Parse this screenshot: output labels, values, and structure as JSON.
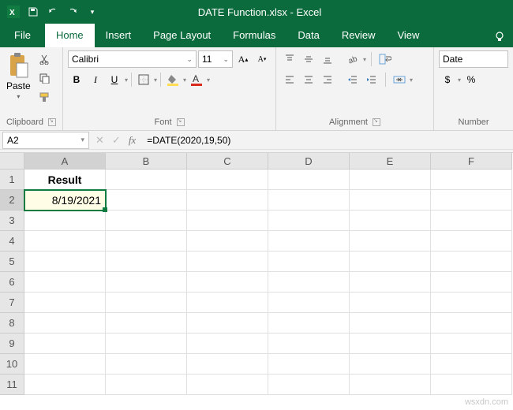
{
  "titlebar": {
    "title": "DATE Function.xlsx - Excel"
  },
  "tabs": {
    "file": "File",
    "items": [
      "Home",
      "Insert",
      "Page Layout",
      "Formulas",
      "Data",
      "Review",
      "View"
    ],
    "active": 0
  },
  "ribbon": {
    "clipboard": {
      "label": "Clipboard",
      "paste": "Paste"
    },
    "font": {
      "label": "Font",
      "name": "Calibri",
      "size": "11",
      "bold": "B",
      "italic": "I",
      "underline": "U"
    },
    "alignment": {
      "label": "Alignment"
    },
    "number": {
      "label": "Number",
      "format": "Date",
      "currency": "$",
      "percent": "%"
    }
  },
  "formulabar": {
    "namebox": "A2",
    "formula": "=DATE(2020,19,50)"
  },
  "grid": {
    "columns": [
      "A",
      "B",
      "C",
      "D",
      "E",
      "F"
    ],
    "rows": [
      "1",
      "2",
      "3",
      "4",
      "5",
      "6",
      "7",
      "8",
      "9",
      "10",
      "11"
    ],
    "a1": "Result",
    "a2": "8/19/2021",
    "selected_col": "A",
    "selected_row": "2"
  },
  "watermark": "wsxdn.com"
}
